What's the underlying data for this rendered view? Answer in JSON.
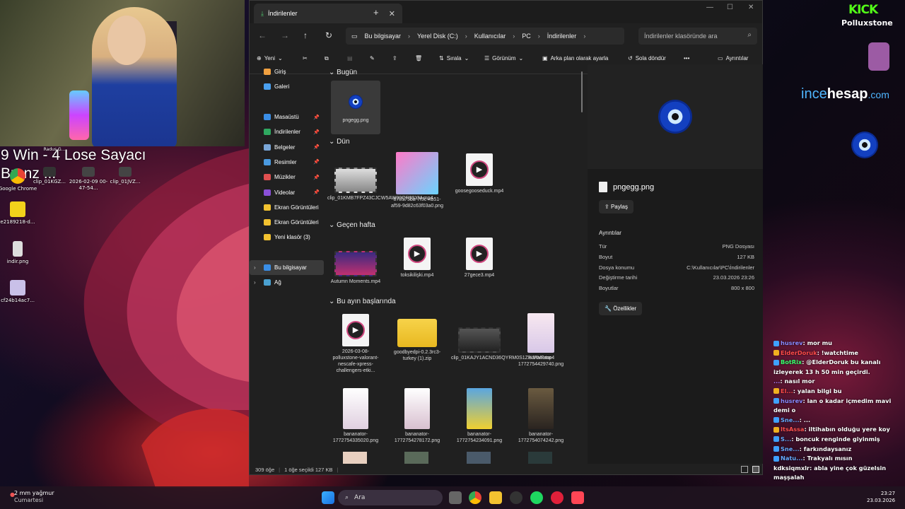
{
  "overlay": {
    "counter_line1": "9 Win - 4 Lose Sayacı",
    "counter_line2": "Bronz III"
  },
  "desktop_icons": [
    {
      "label": "Google Chrome"
    },
    {
      "label": "clip_01KGZ..."
    },
    {
      "label": "2026-02-09 00-47-54..."
    },
    {
      "label": "clip_01JVZ..."
    },
    {
      "label": "Radus G..."
    },
    {
      "label": "e2189218-d..."
    },
    {
      "label": "indir.png"
    },
    {
      "label": "cf24b14ac7..."
    }
  ],
  "explorer": {
    "tab_title": "İndirilenler",
    "breadcrumb": [
      "Bu bilgisayar",
      "Yerel Disk (C:)",
      "Kullanıcılar",
      "PC",
      "İndirilenler"
    ],
    "search_placeholder": "İndirilenler klasöründe ara",
    "toolbar": {
      "new": "Yeni",
      "sort": "Sırala",
      "view": "Görünüm",
      "set_background": "Arka plan olarak ayarla",
      "rotate_left": "Sola döndür",
      "more": "•••",
      "details": "Ayrıntılar"
    },
    "sidebar": [
      "Giriş",
      "Galeri",
      "Masaüstü",
      "İndirilenler",
      "Belgeler",
      "Resimler",
      "Müzikler",
      "Videolar",
      "Ekran Görüntüleri",
      "Ekran Görüntüleri",
      "Yeni klasör (3)",
      "Bu bilgisayar",
      "Ağ"
    ],
    "groups": {
      "today": "Bugün",
      "yesterday": "Dün",
      "last_week": "Geçen hafta",
      "this_month": "Bu ayın başlarında"
    },
    "files": {
      "f1": "pngegg.png",
      "f2": "clip_01KMB7FPZ43CJCW5AW00QR99XM.mp4",
      "f3": "878575ba-7f5c-4b51-af59-9d82c63f03a0.png",
      "f4": "goosegooseduck.mp4",
      "f5": "Autumn Moments.mp4",
      "f6": "toksikilişki.mp4",
      "f7": "27gece3.mp4",
      "f8": "2026-03-08-polluxstone-valorant-nescafe-xpress-challengers-etki...",
      "f9": "goodbyedpi-0.2.3rc3-turkey (1).zip",
      "f10": "clip_01KAJY1ACND36QYRM0S1ZHJRVF.mp4",
      "f11": "bananator-1772754429740.png",
      "f12": "bananator-1772754335020.png",
      "f13": "bananator-1772754278172.png",
      "f14": "bananator-1772754234091.png",
      "f15": "bananator-1772754074242.png"
    },
    "preview": {
      "file_name": "pngegg.png",
      "share": "Paylaş",
      "section": "Ayrıntılar",
      "rows": [
        {
          "k": "Tür",
          "v": "PNG Dosyası"
        },
        {
          "k": "Boyut",
          "v": "127 KB"
        },
        {
          "k": "Dosya konumu",
          "v": "C:\\Kullanıcılar\\PC\\İndirilenler"
        },
        {
          "k": "Değiştirme tarihi",
          "v": "23.03.2026 23:26"
        },
        {
          "k": "Boyutlar",
          "v": "800 x 800"
        }
      ],
      "properties": "Özellikler"
    },
    "status": {
      "count": "309 öğe",
      "selected": "1 öğe seçildi  127 KB"
    }
  },
  "stream": {
    "platform": "KICK",
    "user": "Polluxstone",
    "sponsor_a": "ince",
    "sponsor_b": "hesap",
    "sponsor_c": ".com"
  },
  "chat": [
    {
      "user": "husrev",
      "color": "#8a8aff",
      "msg": ": mor mu"
    },
    {
      "user": "ElderDoruk",
      "color": "#ff4a4a",
      "msg": ": !watchtime"
    },
    {
      "user": "BotRix",
      "color": "#3cff6e",
      "msg": ": @ElderDoruk bu kanalı izleyerek 13 h 50 min geçirdi."
    },
    {
      "user": "...",
      "color": "#b080ff",
      "msg": ": nasıl mor"
    },
    {
      "user": "El...",
      "color": "#ff4a4a",
      "msg": ": yalan bilgi bu"
    },
    {
      "user": "husrev",
      "color": "#8a8aff",
      "msg": ": lan o kadar içmedim mavi demi o"
    },
    {
      "user": "Sne...",
      "color": "#66aaff",
      "msg": ": ..."
    },
    {
      "user": "ItsAssa",
      "color": "#ff5050",
      "msg": ": iltihabın olduğu yere koy"
    },
    {
      "user": "S...",
      "color": "#66aaff",
      "msg": ": boncuk renginde giyinmiş"
    },
    {
      "user": "Sne...",
      "color": "#66aaff",
      "msg": ": farkındaysanız"
    },
    {
      "user": "Natu...",
      "color": "#66aaff",
      "msg": ": Trakyalı mısın"
    },
    {
      "user": "kdksiqmxlr",
      "color": "#ffffff",
      "msg": ": abla yine çok güzelsin maşşalah"
    }
  ],
  "taskbar": {
    "weather_temp": "2 mm yağmur",
    "weather_day": "Cumartesi",
    "search": "Ara",
    "time": "23:27",
    "date": "23.03.2026"
  }
}
